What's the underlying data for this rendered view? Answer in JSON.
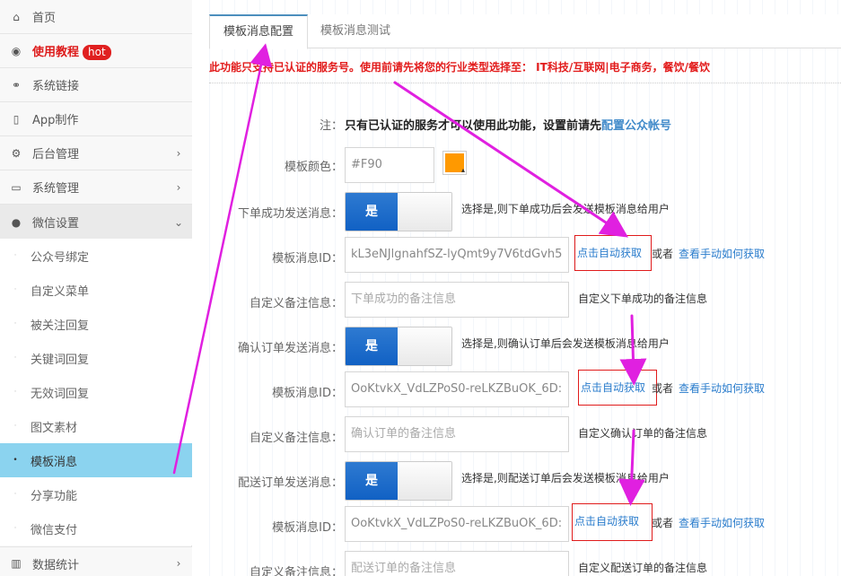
{
  "sidebar": {
    "items": [
      {
        "label": "首页",
        "icon": "home-icon",
        "glyph": "⌂"
      },
      {
        "label": "使用教程",
        "badge": "hot",
        "icon": "play-circle-icon",
        "glyph": "◉"
      },
      {
        "label": "系统链接",
        "icon": "link-icon",
        "glyph": "⚭"
      },
      {
        "label": "App制作",
        "icon": "tablet-icon",
        "glyph": "▯"
      },
      {
        "label": "后台管理",
        "icon": "cogs-icon",
        "glyph": "⚙"
      },
      {
        "label": "系统管理",
        "icon": "desktop-icon",
        "glyph": "▭"
      },
      {
        "label": "微信设置",
        "icon": "comments-icon",
        "glyph": "💬"
      }
    ],
    "sub_items": [
      "公众号绑定",
      "自定义菜单",
      "被关注回复",
      "关键词回复",
      "无效词回复",
      "图文素材",
      "模板消息",
      "分享功能",
      "微信支付"
    ],
    "bottom_item": {
      "label": "数据统计",
      "icon": "bar-chart-icon",
      "glyph": "▥"
    }
  },
  "tabs": [
    "模板消息配置",
    "模板消息测试"
  ],
  "notice": "此功能只支持已认证的服务号。使用前请先将您的行业类型选择至： IT科技/互联网|电子商务，餐饮/餐饮",
  "form": {
    "note_label": "注：",
    "note_text": "只有已认证的服务才可以使用此功能，设置前请先",
    "note_link": "配置公众帐号",
    "color_label": "模板颜色：",
    "color_value": "#F90",
    "swatch_color": "#ff9900",
    "sections": [
      {
        "switch_label": "下单成功发送消息：",
        "switch_on": "是",
        "switch_help": "选择是,则下单成功后会发送模板消息给用户",
        "id_label": "模板消息ID：",
        "id_value": "kL3eNJlgnahfSZ-lyQmt9y7V6tdGvh5",
        "fetch_label": "点击自动获取",
        "or_label": "或者",
        "howto_label": "查看手动如何获取",
        "remark_label": "自定义备注信息：",
        "remark_placeholder": "下单成功的备注信息",
        "remark_help": "自定义下单成功的备注信息"
      },
      {
        "switch_label": "确认订单发送消息：",
        "switch_on": "是",
        "switch_help": "选择是,则确认订单后会发送模板消息给用户",
        "id_label": "模板消息ID：",
        "id_value": "OoKtvkX_VdLZPoS0-reLKZBuOK_6D:",
        "fetch_label": "点击自动获取",
        "or_label": "或者",
        "howto_label": "查看手动如何获取",
        "remark_label": "自定义备注信息：",
        "remark_placeholder": "确认订单的备注信息",
        "remark_help": "自定义确认订单的备注信息"
      },
      {
        "switch_label": "配送订单发送消息：",
        "switch_on": "是",
        "switch_help": "选择是,则配送订单后会发送模板消息给用户",
        "id_label": "模板消息ID：",
        "id_value": "OoKtvkX_VdLZPoS0-reLKZBuOK_6D:",
        "fetch_label": "点击自动获取",
        "or_label": "或者",
        "howto_label": "查看手动如何获取",
        "remark_label": "自定义备注信息：",
        "remark_placeholder": "配送订单的备注信息",
        "remark_help": "自定义配送订单的备注信息"
      }
    ]
  },
  "colors": {
    "accent_blue": "#1161c4",
    "link_blue": "#2a7ccc",
    "alert_red": "#e21b1b",
    "annotation_magenta": "#e020e0",
    "active_sub_bg": "#8bd3ef"
  }
}
